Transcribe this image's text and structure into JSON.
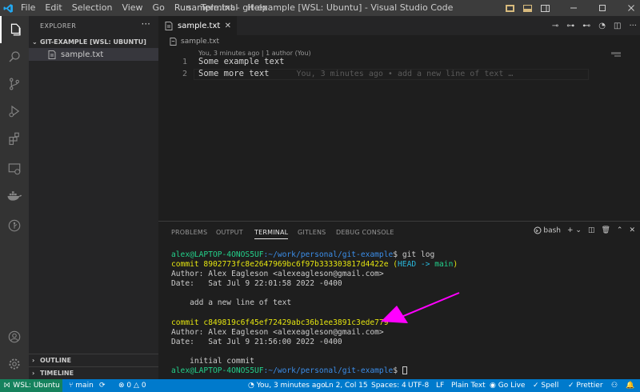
{
  "window": {
    "title": "sample.txt - git-example [WSL: Ubuntu] - Visual Studio Code",
    "menu": [
      "File",
      "Edit",
      "Selection",
      "View",
      "Go",
      "Run",
      "Terminal",
      "Help"
    ]
  },
  "activity_icons": [
    "explorer-icon",
    "search-icon",
    "source-control-icon",
    "run-debug-icon",
    "extensions-icon",
    "remote-explorer-icon",
    "docker-icon",
    "gitlens-icon",
    "account-icon",
    "settings-gear-icon"
  ],
  "sidebar": {
    "title": "EXPLORER",
    "folder": "GIT-EXAMPLE [WSL: UBUNTU]",
    "files": [
      "sample.txt"
    ],
    "outline": "OUTLINE",
    "timeline": "TIMELINE"
  },
  "editor": {
    "tab_label": "sample.txt",
    "breadcrumb": "sample.txt",
    "codelens": "You, 3 minutes ago | 1 author (You)",
    "line_numbers": [
      "1",
      "2"
    ],
    "lines": [
      "Some example text",
      "Some more text"
    ],
    "blame": "You, 3 minutes ago • add a new line of text …"
  },
  "panel": {
    "tabs": [
      "PROBLEMS",
      "OUTPUT",
      "TERMINAL",
      "GITLENS",
      "DEBUG CONSOLE"
    ],
    "active_tab": "TERMINAL",
    "shell": "bash",
    "terminal": {
      "prompt_user": "alex@LAPTOP-4ONOS5UF",
      "prompt_path": ":~/work/personal/git-example",
      "prompt_symbol": "$ ",
      "command": "git log",
      "commit1_label": "commit 8902773fc8e2647969bc6f97b333303817d4422e",
      "commit1_ref_open": " (",
      "commit1_head": "HEAD -> ",
      "commit1_branch": "main",
      "commit1_ref_close": ")",
      "author1": "Author: Alex Eagleson <alexeagleson@gmail.com>",
      "date1": "Date:   Sat Jul 9 22:01:58 2022 -0400",
      "message1": "    add a new line of text",
      "commit2_label": "commit c849819c6f45ef72429abc36b1ee3891c3ede779",
      "author2": "Author: Alex Eagleson <alexeagleson@gmail.com>",
      "date2": "Date:   Sat Jul 9 21:56:00 2022 -0400",
      "message2": "    initial commit"
    }
  },
  "statusbar": {
    "remote": "WSL: Ubuntu",
    "branch": "main",
    "errors": "0",
    "warnings": "0",
    "blame": "You, 3 minutes ago",
    "position": "Ln 2, Col 15",
    "spaces": "Spaces: 4",
    "encoding": "UTF-8",
    "eol": "LF",
    "language": "Plain Text",
    "golive": "Go Live",
    "spell": "Spell",
    "prettier": "Prettier"
  },
  "colors": {
    "accent": "#007acc",
    "remote": "#16825d",
    "annotation_arrow": "#ff00ff"
  }
}
